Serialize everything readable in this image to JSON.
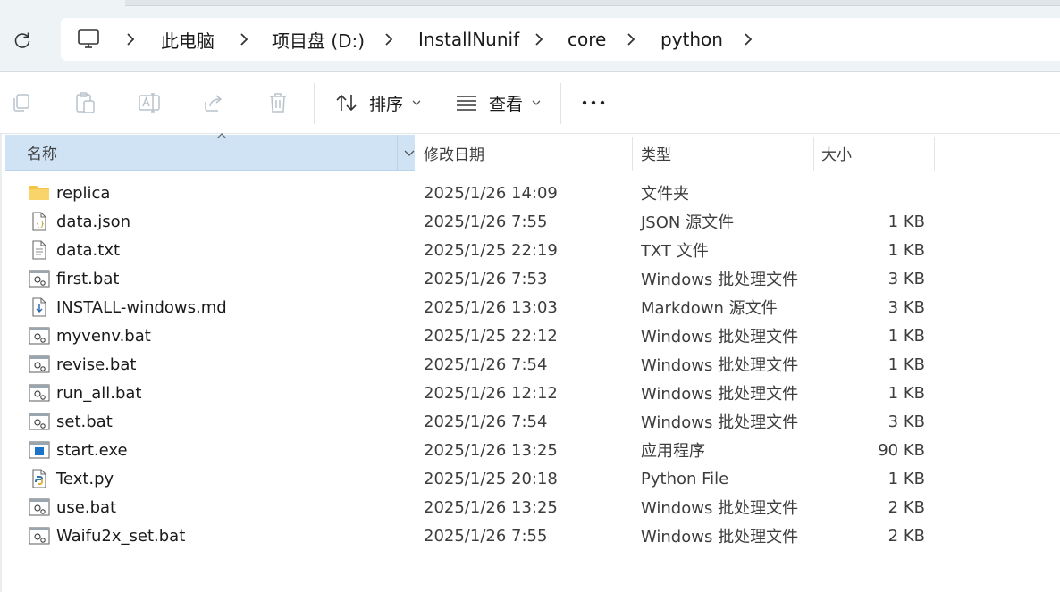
{
  "breadcrumb": {
    "items": [
      "此电脑",
      "项目盘 (D:)",
      "InstallNunif",
      "core",
      "python"
    ]
  },
  "toolbar": {
    "sort_label": "排序",
    "view_label": "查看"
  },
  "columns": {
    "name": "名称",
    "date": "修改日期",
    "type": "类型",
    "size": "大小"
  },
  "files": [
    {
      "name": "replica",
      "date": "2025/1/26 14:09",
      "type": "文件夹",
      "size": "",
      "icon": "folder-icon"
    },
    {
      "name": "data.json",
      "date": "2025/1/26 7:55",
      "type": "JSON 源文件",
      "size": "1 KB",
      "icon": "json-file-icon"
    },
    {
      "name": "data.txt",
      "date": "2025/1/25 22:19",
      "type": "TXT 文件",
      "size": "1 KB",
      "icon": "text-file-icon"
    },
    {
      "name": "first.bat",
      "date": "2025/1/26 7:53",
      "type": "Windows 批处理文件",
      "size": "3 KB",
      "icon": "batch-file-icon"
    },
    {
      "name": "INSTALL-windows.md",
      "date": "2025/1/26 13:03",
      "type": "Markdown 源文件",
      "size": "3 KB",
      "icon": "markdown-file-icon"
    },
    {
      "name": "myvenv.bat",
      "date": "2025/1/25 22:12",
      "type": "Windows 批处理文件",
      "size": "1 KB",
      "icon": "batch-file-icon"
    },
    {
      "name": "revise.bat",
      "date": "2025/1/26 7:54",
      "type": "Windows 批处理文件",
      "size": "1 KB",
      "icon": "batch-file-icon"
    },
    {
      "name": "run_all.bat",
      "date": "2025/1/26 12:12",
      "type": "Windows 批处理文件",
      "size": "1 KB",
      "icon": "batch-file-icon"
    },
    {
      "name": "set.bat",
      "date": "2025/1/26 7:54",
      "type": "Windows 批处理文件",
      "size": "3 KB",
      "icon": "batch-file-icon"
    },
    {
      "name": "start.exe",
      "date": "2025/1/26 13:25",
      "type": "应用程序",
      "size": "90 KB",
      "icon": "exe-file-icon"
    },
    {
      "name": "Text.py",
      "date": "2025/1/25 20:18",
      "type": "Python File",
      "size": "1 KB",
      "icon": "python-file-icon"
    },
    {
      "name": "use.bat",
      "date": "2025/1/26 13:25",
      "type": "Windows 批处理文件",
      "size": "2 KB",
      "icon": "batch-file-icon"
    },
    {
      "name": "Waifu2x_set.bat",
      "date": "2025/1/26 7:55",
      "type": "Windows 批处理文件",
      "size": "2 KB",
      "icon": "batch-file-icon"
    }
  ],
  "colors": {
    "header_selected": "#cfe3f5",
    "address_bg": "#eef3f6",
    "folder": "#f4c542"
  }
}
